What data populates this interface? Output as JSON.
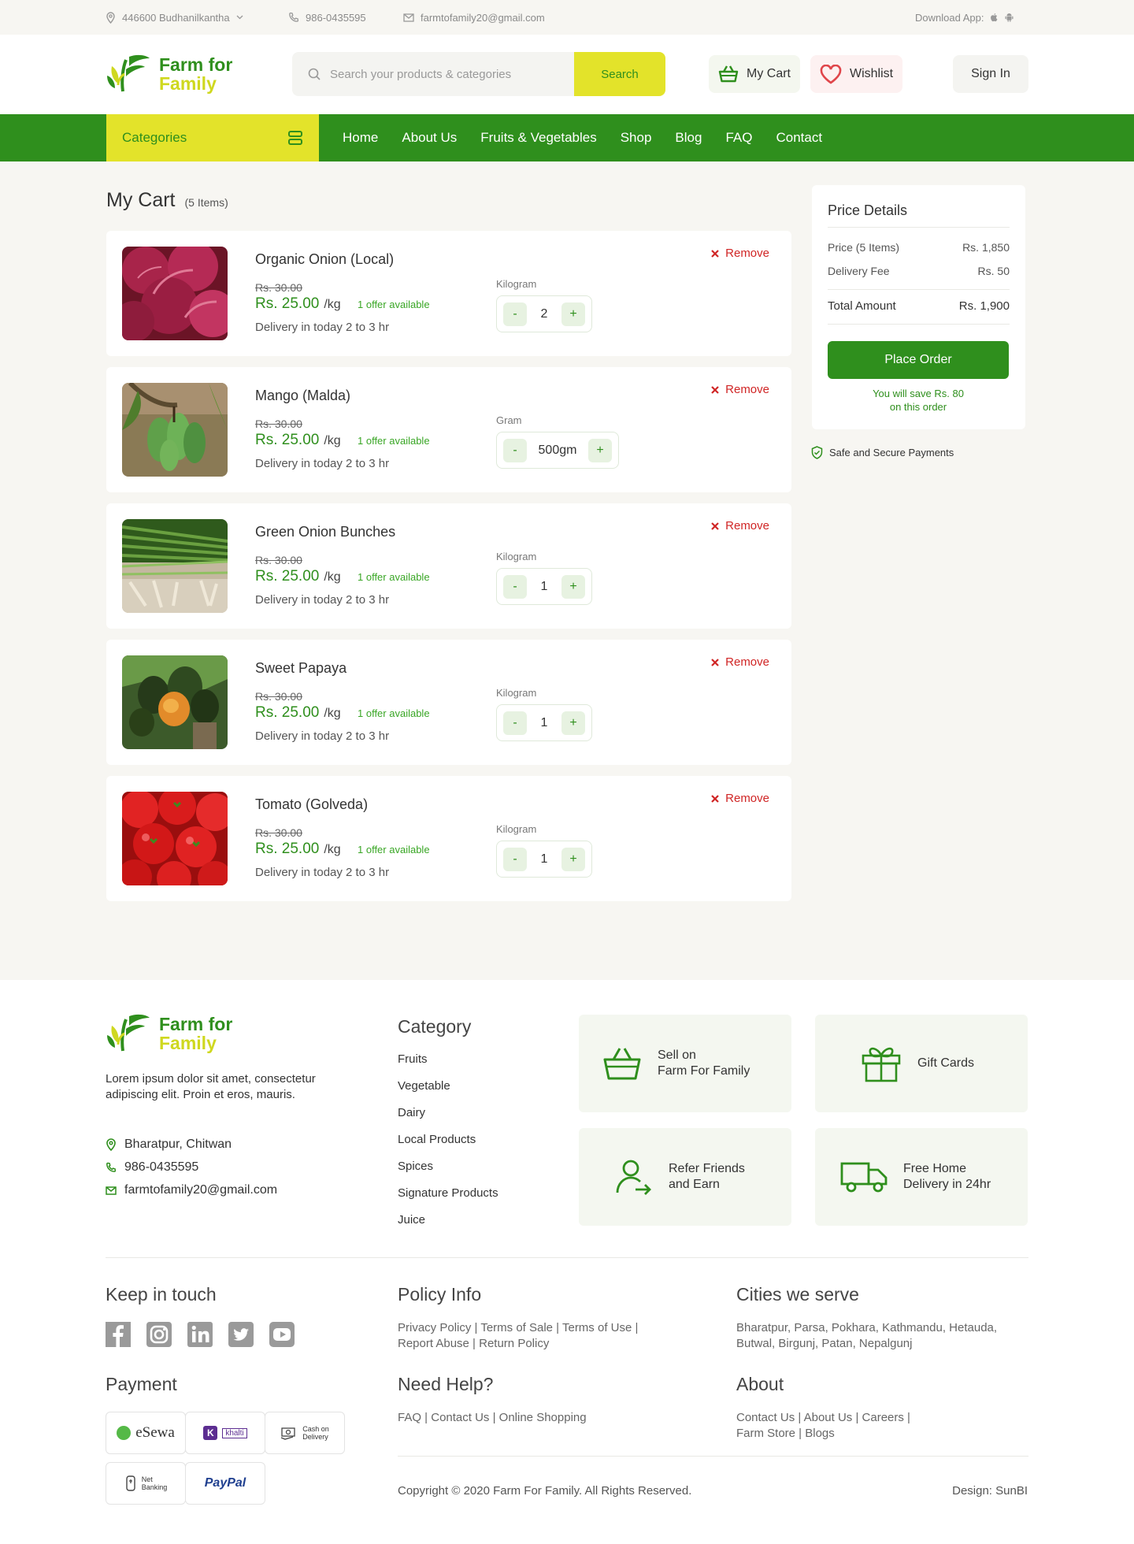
{
  "topbar": {
    "location": "446600 Budhanilkantha",
    "phone": "986-0435595",
    "email": "farmtofamily20@gmail.com",
    "download_label": "Download App:"
  },
  "brand": {
    "line1": "Farm for",
    "line2": "Family"
  },
  "search": {
    "placeholder": "Search your products & categories",
    "button": "Search"
  },
  "header_actions": {
    "cart": "My Cart",
    "wishlist": "Wishlist",
    "signin": "Sign In"
  },
  "nav": {
    "categories": "Categories",
    "links": [
      "Home",
      "About Us",
      "Fruits & Vegetables",
      "Shop",
      "Blog",
      "FAQ",
      "Contact"
    ]
  },
  "cart": {
    "title": "My Cart",
    "count": "(5 Items)",
    "remove_label": "Remove",
    "items": [
      {
        "name": "Organic Onion (Local)",
        "old_price": "Rs. 30.00",
        "price": "Rs. 25.00",
        "unit_suffix": "/kg",
        "offer": "1 offer available",
        "delivery": "Delivery in today 2 to 3 hr",
        "unit_label": "Kilogram",
        "qty": "2"
      },
      {
        "name": "Mango (Malda)",
        "old_price": "Rs. 30.00",
        "price": "Rs. 25.00",
        "unit_suffix": "/kg",
        "offer": "1 offer available",
        "delivery": "Delivery in today 2 to 3 hr",
        "unit_label": "Gram",
        "qty": "500gm"
      },
      {
        "name": "Green Onion Bunches",
        "old_price": "Rs. 30.00",
        "price": "Rs. 25.00",
        "unit_suffix": "/kg",
        "offer": "1 offer available",
        "delivery": "Delivery in today 2 to 3 hr",
        "unit_label": "Kilogram",
        "qty": "1"
      },
      {
        "name": "Sweet Papaya",
        "old_price": "Rs. 30.00",
        "price": "Rs. 25.00",
        "unit_suffix": "/kg",
        "offer": "1 offer available",
        "delivery": "Delivery in today 2 to 3 hr",
        "unit_label": "Kilogram",
        "qty": "1"
      },
      {
        "name": "Tomato (Golveda)",
        "old_price": "Rs. 30.00",
        "price": "Rs. 25.00",
        "unit_suffix": "/kg",
        "offer": "1 offer available",
        "delivery": "Delivery in today 2 to 3 hr",
        "unit_label": "Kilogram",
        "qty": "1"
      }
    ]
  },
  "price_details": {
    "title": "Price Details",
    "price_label": "Price (5 Items)",
    "price_value": "Rs. 1,850",
    "delivery_label": "Delivery Fee",
    "delivery_value": "Rs. 50",
    "total_label": "Total Amount",
    "total_value": "Rs. 1,900",
    "button": "Place Order",
    "save_line1": "You will save Rs. 80",
    "save_line2": "on this order",
    "secure": "Safe and Secure Payments"
  },
  "footer": {
    "description": "Lorem ipsum dolor sit amet, consectetur adipiscing elit. Proin et eros, mauris.",
    "address": "Bharatpur, Chitwan",
    "phone": "986-0435595",
    "email": "farmtofamily20@gmail.com",
    "category_title": "Category",
    "categories": [
      "Fruits",
      "Vegetable",
      "Dairy",
      "Local Products",
      "Spices",
      "Signature Products",
      "Juice"
    ],
    "tiles": [
      {
        "line1": "Sell on",
        "line2": "Farm For Family"
      },
      {
        "line1": "Gift Cards",
        "line2": ""
      },
      {
        "line1": "Refer Friends",
        "line2": "and Earn"
      },
      {
        "line1": "Free Home",
        "line2": "Delivery in 24hr"
      }
    ],
    "keep_in_touch": "Keep in touch",
    "payment_title": "Payment",
    "payments": {
      "esewa": "eSewa",
      "khalti": "khalti",
      "cod_1": "Cash on",
      "cod_2": "Delivery",
      "net_1": "Net",
      "net_2": "Banking",
      "paypal": "PayPal"
    },
    "policy_title": "Policy Info",
    "policy_line1": "Privacy Policy | Terms of Sale | Terms of Use |",
    "policy_line2": "Report Abuse | Return Policy",
    "help_title": "Need Help?",
    "help_line": "FAQ | Contact Us | Online Shopping",
    "cities_title": "Cities we serve",
    "cities_line1": "Bharatpur, Parsa, Pokhara, Kathmandu, Hetauda,",
    "cities_line2": "Butwal, Birgunj, Patan, Nepalgunj",
    "about_title": "About",
    "about_line1": "Contact Us | About Us | Careers |",
    "about_line2": "Farm Store | Blogs",
    "copyright": "Copyright © 2020 Farm For Family. All Rights Reserved.",
    "design": "Design: SunBI"
  },
  "colors": {
    "brand_green": "#2f8f1d",
    "brand_yellow": "#e3e32a",
    "remove_red": "#d02525"
  }
}
